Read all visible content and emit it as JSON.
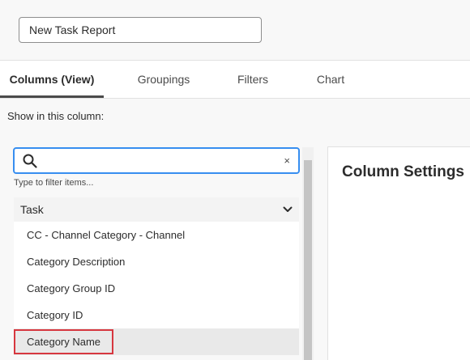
{
  "report": {
    "name": "New Task Report"
  },
  "tabs": [
    {
      "label": "Columns (View)",
      "active": true
    },
    {
      "label": "Groupings",
      "active": false
    },
    {
      "label": "Filters",
      "active": false
    },
    {
      "label": "Chart",
      "active": false
    }
  ],
  "columns": {
    "show_label": "Show in this column:",
    "search": {
      "value": "",
      "placeholder": "",
      "hint": "Type to filter items...",
      "clear_glyph": "×"
    },
    "group": {
      "label": "Task",
      "icon": "chevron-down-icon"
    },
    "items": [
      {
        "label": "CC - Channel Category - Channel",
        "selected": false
      },
      {
        "label": "Category Description",
        "selected": false
      },
      {
        "label": "Category Group ID",
        "selected": false
      },
      {
        "label": "Category ID",
        "selected": false
      },
      {
        "label": "Category Name",
        "selected": true
      }
    ]
  },
  "settings": {
    "title": "Column Settings"
  },
  "colors": {
    "focus": "#378ef0",
    "highlight": "#d7373f",
    "tab_underline": "#4b4b4b"
  }
}
